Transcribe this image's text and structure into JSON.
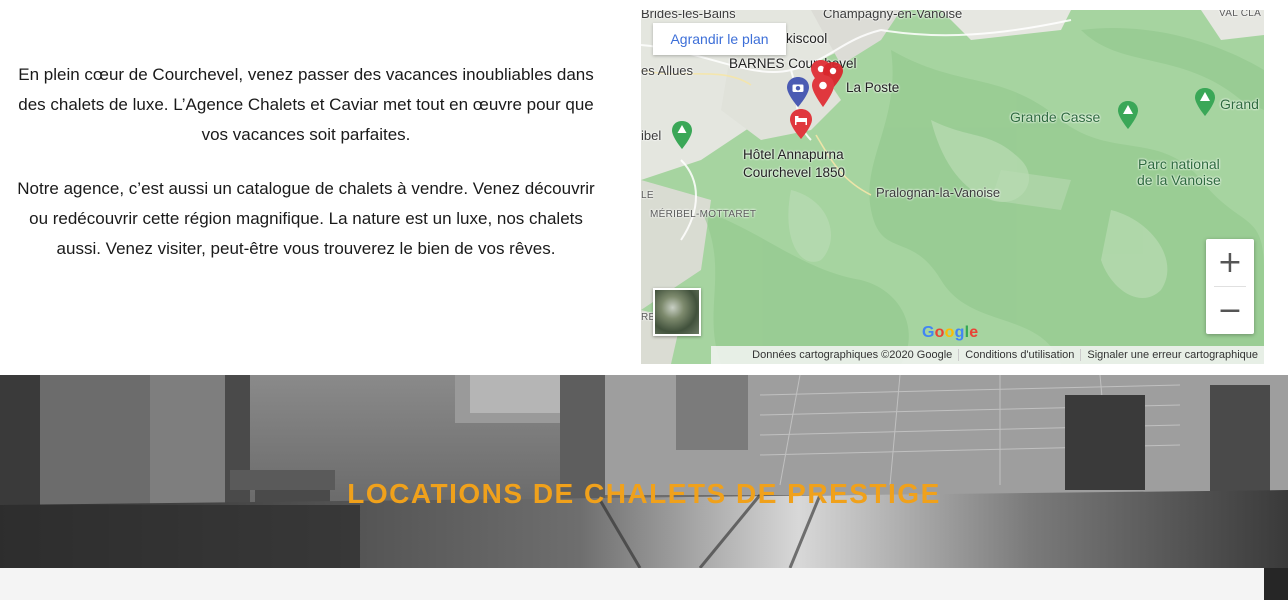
{
  "intro": {
    "paragraph1": "En plein cœur de Courchevel, venez passer des vacances inoubliables dans des chalets de luxe. L’Agence Chalets et Caviar met tout en œuvre pour que vos vacances soit parfaites.",
    "paragraph2": "Notre agence, c’est aussi un catalogue de chalets à vendre. Venez découvrir ou redécouvrir cette région magnifique. La nature est un luxe, nos chalets aussi. Venez visiter, peut-être vous trouverez le bien de vos rêves."
  },
  "map": {
    "enlarge_label": "Agrandir le plan",
    "labels": {
      "brides": "Brides-les-Bains",
      "champagny": "Champagny-en-Vanoise",
      "valcla": "VAL CLA",
      "skiscool": "kiscool",
      "allues": "es Allues",
      "barnes": "BARNES Courchevel",
      "laposte": "La Poste",
      "grandecasse": "Grande Casse",
      "grand": "Grand",
      "meribel": "ibel",
      "annapurna1": "Hôtel Annapurna",
      "annapurna2": "Courchevel 1850",
      "parc1": "Parc national",
      "parc2": "de la Vanoise",
      "pralognan": "Pralognan-la-Vanoise",
      "mottaret": "MÉRIBEL-MOTTARET",
      "le": "LE",
      "res": "RES"
    },
    "zoom_in": "+",
    "zoom_out": "−",
    "google_logo": [
      "G",
      "o",
      "o",
      "g",
      "l",
      "e"
    ],
    "google_colors": [
      "#4285F4",
      "#EA4335",
      "#FBBC05",
      "#4285F4",
      "#34A853",
      "#EA4335"
    ],
    "footer": {
      "data": "Données cartographiques ©2020 Google",
      "terms": "Conditions d'utilisation",
      "report": "Signaler une erreur cartographique"
    },
    "icons": [
      "camera-pin-icon",
      "marker-pin-icon",
      "hotel-pin-icon",
      "park-pin-icon",
      "mountain-pin-icon"
    ]
  },
  "hero": {
    "title": "LOCATIONS DE CHALETS DE PRESTIGE",
    "title_color": "#f0a11b"
  }
}
